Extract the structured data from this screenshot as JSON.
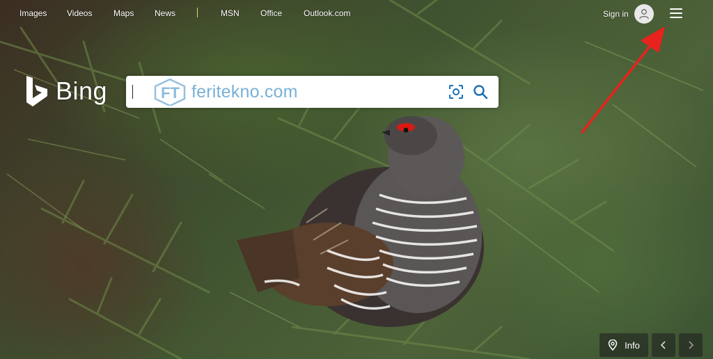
{
  "nav": {
    "links": [
      "Images",
      "Videos",
      "Maps",
      "News",
      "MSN",
      "Office",
      "Outlook.com"
    ]
  },
  "account": {
    "signin_label": "Sign in"
  },
  "logo": {
    "text": "Bing"
  },
  "search": {
    "value": "",
    "watermark": "feritekno.com"
  },
  "controls": {
    "info_label": "Info"
  },
  "colors": {
    "annotation_arrow": "#e8221c",
    "watermark": "#7ab0d6",
    "nav_separator": "#d8e070"
  },
  "icons": {
    "menu": "hamburger-icon",
    "avatar": "user-icon",
    "visual_search": "camera-scan-icon",
    "search": "search-icon",
    "info": "location-pin-icon",
    "prev": "chevron-left-icon",
    "next": "chevron-right-icon"
  }
}
